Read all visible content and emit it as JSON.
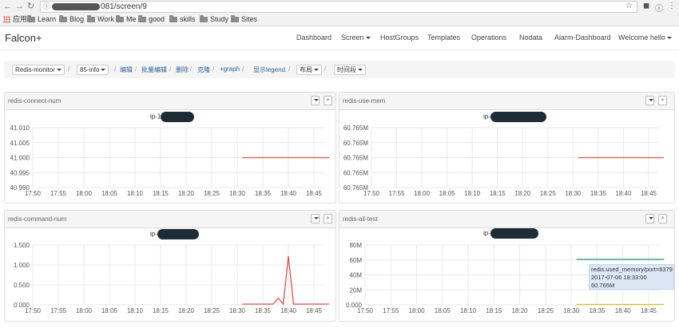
{
  "browser": {
    "url_suffix": "081/screen/9",
    "bookmarks": [
      "应用",
      "Learn",
      "Blog",
      "Work",
      "Me",
      "good",
      "skills",
      "Study",
      "Sites"
    ]
  },
  "nav": {
    "brand": "Falcon+",
    "items": [
      "Dashboard",
      "Screen",
      "HostGroups",
      "Templates",
      "Operations",
      "Nodata",
      "Alarm-Dashboard",
      "Welcome hello"
    ]
  },
  "toolbar": {
    "screen_select": "Redis-monitor",
    "sub_select": "85-info",
    "links": [
      "编辑",
      "批量编辑",
      "删除",
      "克隆",
      "+graph",
      "显示legend"
    ],
    "layout_select": "布局",
    "time_select": "时间段"
  },
  "panels": [
    {
      "title": "redis-connect-num",
      "ip_prefix": "ip-1"
    },
    {
      "title": "redis-use-mem",
      "ip_prefix": "ip-"
    },
    {
      "title": "redis-command-num",
      "ip_prefix": "ip-"
    },
    {
      "title": "redis-all-test",
      "ip_prefix": "ip-"
    }
  ],
  "tooltip": {
    "line1": "redis.used_memory/port=6379",
    "line2": "2017-07-06 18:33:00",
    "line3": "60.765M"
  },
  "colors": {
    "red": "#d9534f",
    "teal": "#2e8b7a",
    "yellow": "#d4c21c",
    "grid": "#eaeaea"
  },
  "chart_data": [
    {
      "type": "line",
      "title": "redis-connect-num",
      "x_ticks": [
        "17:50",
        "17:55",
        "18:00",
        "18:05",
        "18:10",
        "18:15",
        "18:20",
        "18:25",
        "18:30",
        "18:35",
        "18:40",
        "18:45"
      ],
      "y_ticks": [
        "41.010",
        "41.005",
        "41.000",
        "40.995",
        "40.990"
      ],
      "ylim": [
        40.99,
        41.01
      ],
      "series": [
        {
          "color": "#d9534f",
          "x": [
            "18:31",
            "18:48"
          ],
          "values": [
            41.0,
            41.0
          ]
        }
      ]
    },
    {
      "type": "line",
      "title": "redis-use-mem",
      "x_ticks": [
        "17:50",
        "17:55",
        "18:00",
        "18:05",
        "18:10",
        "18:15",
        "18:20",
        "18:25",
        "18:30",
        "18:35",
        "18:40",
        "18:45"
      ],
      "y_ticks": [
        "60.765M",
        "60.765M",
        "60.765M",
        "60.765M",
        "60.765M"
      ],
      "ylim": [
        0,
        4
      ],
      "series": [
        {
          "color": "#d9534f",
          "x": [
            "18:31",
            "18:48"
          ],
          "values": [
            2,
            2
          ]
        }
      ]
    },
    {
      "type": "line",
      "title": "redis-command-num",
      "x_ticks": [
        "17:50",
        "17:55",
        "18:00",
        "18:05",
        "18:10",
        "18:15",
        "18:20",
        "18:25",
        "18:30",
        "18:35",
        "18:40",
        "18:45"
      ],
      "y_ticks": [
        "1.500",
        "1.000",
        "0.500",
        "0.000"
      ],
      "ylim": [
        0,
        1.5
      ],
      "series": [
        {
          "color": "#d9534f",
          "x": [
            "18:31",
            "18:35",
            "18:37",
            "18:38",
            "18:39",
            "18:40",
            "18:41",
            "18:42",
            "18:43",
            "18:48"
          ],
          "values": [
            0.02,
            0.02,
            0.02,
            0.17,
            0.02,
            1.22,
            0.02,
            0.02,
            0.02,
            0.02
          ]
        }
      ]
    },
    {
      "type": "line",
      "title": "redis-all-test",
      "x_ticks": [
        "17:50",
        "17:55",
        "18:00",
        "18:05",
        "18:10",
        "18:15",
        "18:20",
        "18:25",
        "18:30",
        "18:35",
        "18:40",
        "18:45"
      ],
      "y_ticks": [
        "80M",
        "60M",
        "40M",
        "20M",
        "0.000"
      ],
      "ylim": [
        0,
        80
      ],
      "series": [
        {
          "color": "#2e8b7a",
          "x": [
            "18:31",
            "18:48"
          ],
          "values": [
            60.765,
            60.765
          ]
        },
        {
          "color": "#d4c21c",
          "x": [
            "18:31",
            "18:48"
          ],
          "values": [
            0.5,
            0.5
          ]
        }
      ]
    }
  ]
}
